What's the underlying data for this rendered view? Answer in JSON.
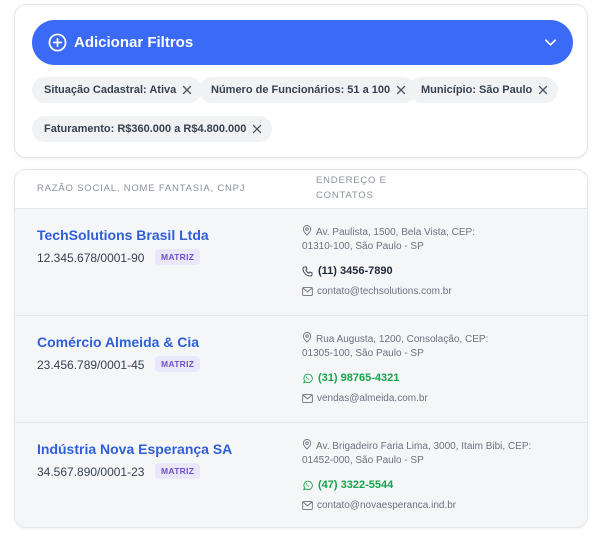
{
  "filters": {
    "add_button_label": "Adicionar Filtros",
    "chips": [
      {
        "label": "Situação Cadastral: Ativa"
      },
      {
        "label": "Número de Funcionários: 51 a 100"
      },
      {
        "label": "Município: São Paulo"
      },
      {
        "label": "Faturamento: R$360.000 a R$4.800.000"
      }
    ]
  },
  "table": {
    "headers": {
      "col1": "RAZÃO SOCIAL, NOME FANTASIA, CNPJ",
      "col2_line1": "ENDEREÇO E",
      "col2_line2": "CONTATOS"
    },
    "rows": [
      {
        "name": "TechSolutions Brasil Ltda",
        "cnpj": "12.345.678/0001-90",
        "badge": "MATRIZ",
        "address_line1": "Av. Paulista, 1500, Bela Vista, CEP:",
        "address_line2": "01310-100, São Paulo - SP",
        "phone": "(11) 3456-7890",
        "phone_type": "phone-icon",
        "email": "contato@techsolutions.com.br"
      },
      {
        "name": "Comércio Almeida & Cia",
        "cnpj": "23.456.789/0001-45",
        "badge": "MATRIZ",
        "address_line1": "Rua Augusta, 1200, Consolação, CEP:",
        "address_line2": "01305-100, São Paulo - SP",
        "phone": "(31) 98765-4321",
        "phone_type": "whatsapp-icon",
        "email": "vendas@almeida.com.br"
      },
      {
        "name": "Indústria Nova Esperança SA",
        "cnpj": "34.567.890/0001-23",
        "badge": "MATRIZ",
        "address_line1": "Av. Brigadeiro Faria Lima, 3000, Itaim Bibi, CEP:",
        "address_line2": "01452-000, São Paulo - SP",
        "phone": "(47) 3322-5544",
        "phone_type": "whatsapp-icon",
        "email": "contato@novaesperanca.ind.br"
      }
    ]
  },
  "colors": {
    "primary": "#3b6bf6",
    "link": "#2f5fd8",
    "badge_bg": "#ebe7fb",
    "badge_text": "#6b52c8",
    "whatsapp": "#16a34a"
  }
}
